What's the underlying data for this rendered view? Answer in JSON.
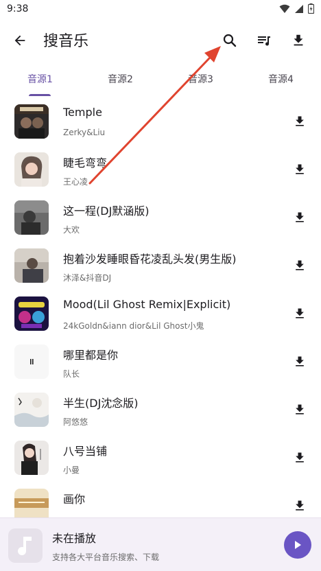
{
  "status": {
    "time": "9:38"
  },
  "appbar": {
    "title": "搜音乐"
  },
  "tabs": [
    {
      "label": "音源1",
      "active": true
    },
    {
      "label": "音源2",
      "active": false
    },
    {
      "label": "音源3",
      "active": false
    },
    {
      "label": "音源4",
      "active": false
    }
  ],
  "songs": [
    {
      "title": "Temple",
      "artist": "Zerky&Liu"
    },
    {
      "title": "睫毛弯弯",
      "artist": "王心凌"
    },
    {
      "title": "这一程(DJ默涵版)",
      "artist": "大欢"
    },
    {
      "title": "抱着沙发睡眼昏花凌乱头发(男生版)",
      "artist": "沐泽&抖音DJ"
    },
    {
      "title": "Mood(Lil Ghost Remix|Explicit)",
      "artist": "24kGoldn&iann dior&Lil Ghost小鬼"
    },
    {
      "title": "哪里都是你",
      "artist": "队长"
    },
    {
      "title": "半生(DJ沈念版)",
      "artist": "阿悠悠"
    },
    {
      "title": "八号当铺",
      "artist": "小曼"
    },
    {
      "title": "画你",
      "artist": ""
    }
  ],
  "player": {
    "title": "未在播放",
    "subtitle": "支持各大平台音乐搜索、下载"
  },
  "colors": {
    "accent": "#6750a4",
    "play_button": "#6a55c4",
    "annotation_arrow": "#e0442f"
  }
}
